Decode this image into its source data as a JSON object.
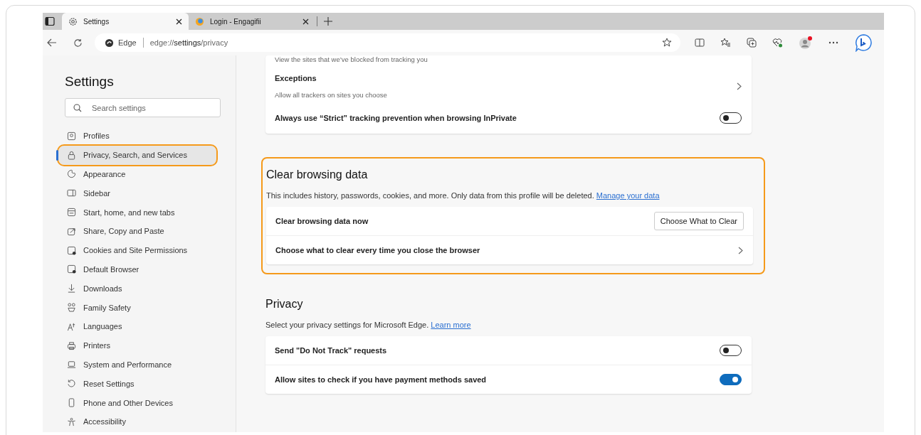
{
  "tabs": [
    {
      "title": "Settings",
      "selected": true
    },
    {
      "title": "Login - Engagifii",
      "selected": false
    }
  ],
  "address_bar": {
    "site_label": "Edge",
    "url": "edge://**settings**/privacy"
  },
  "sidebar": {
    "title": "Settings",
    "search": {
      "placeholder": "Search settings"
    },
    "items": [
      {
        "label": "Profiles",
        "selected": false,
        "highlighted": false
      },
      {
        "label": "Privacy, Search, and Services",
        "selected": true,
        "highlighted": true
      },
      {
        "label": "Appearance",
        "selected": false,
        "highlighted": false
      },
      {
        "label": "Sidebar",
        "selected": false,
        "highlighted": false
      },
      {
        "label": "Start, home, and new tabs",
        "selected": false,
        "highlighted": false
      },
      {
        "label": "Share, Copy and Paste",
        "selected": false,
        "highlighted": false
      },
      {
        "label": "Cookies and Site Permissions",
        "selected": false,
        "highlighted": false
      },
      {
        "label": "Default Browser",
        "selected": false,
        "highlighted": false
      },
      {
        "label": "Downloads",
        "selected": false,
        "highlighted": false
      },
      {
        "label": "Family Safety",
        "selected": false,
        "highlighted": false
      },
      {
        "label": "Languages",
        "selected": false,
        "highlighted": false
      },
      {
        "label": "Printers",
        "selected": false,
        "highlighted": false
      },
      {
        "label": "System and Performance",
        "selected": false,
        "highlighted": false
      },
      {
        "label": "Reset Settings",
        "selected": false,
        "highlighted": false
      },
      {
        "label": "Phone and Other Devices",
        "selected": false,
        "highlighted": false
      },
      {
        "label": "Accessibility",
        "selected": false,
        "highlighted": false
      }
    ]
  },
  "sections": [
    {
      "highlighted": false,
      "rows": [
        {
          "kind": "info",
          "subtitle": "View the sites that we’ve blocked from tracking you"
        },
        {
          "kind": "link",
          "title": "Exceptions",
          "subtitle": "Allow all trackers on sites you choose"
        },
        {
          "kind": "toggle",
          "title": "Always use “Strict” tracking prevention when browsing InPrivate",
          "on": false
        }
      ]
    },
    {
      "heading": "Clear browsing data",
      "description": "This includes history, passwords, cookies, and more. Only data from this profile will be deleted.",
      "link": "Manage your data",
      "highlighted": true,
      "rows": [
        {
          "kind": "button",
          "title": "Clear browsing data now",
          "button": "Choose What to Clear"
        },
        {
          "kind": "link",
          "title": "Choose what to clear every time you close the browser"
        }
      ]
    },
    {
      "heading": "Privacy",
      "description": "Select your privacy settings for Microsoft Edge.",
      "link": "Learn more",
      "highlighted": false,
      "rows": [
        {
          "kind": "toggle",
          "title": "Send \"Do Not Track\" requests",
          "on": false
        },
        {
          "kind": "toggle",
          "title": "Allow sites to check if you have payment methods saved",
          "on": true
        }
      ]
    }
  ]
}
